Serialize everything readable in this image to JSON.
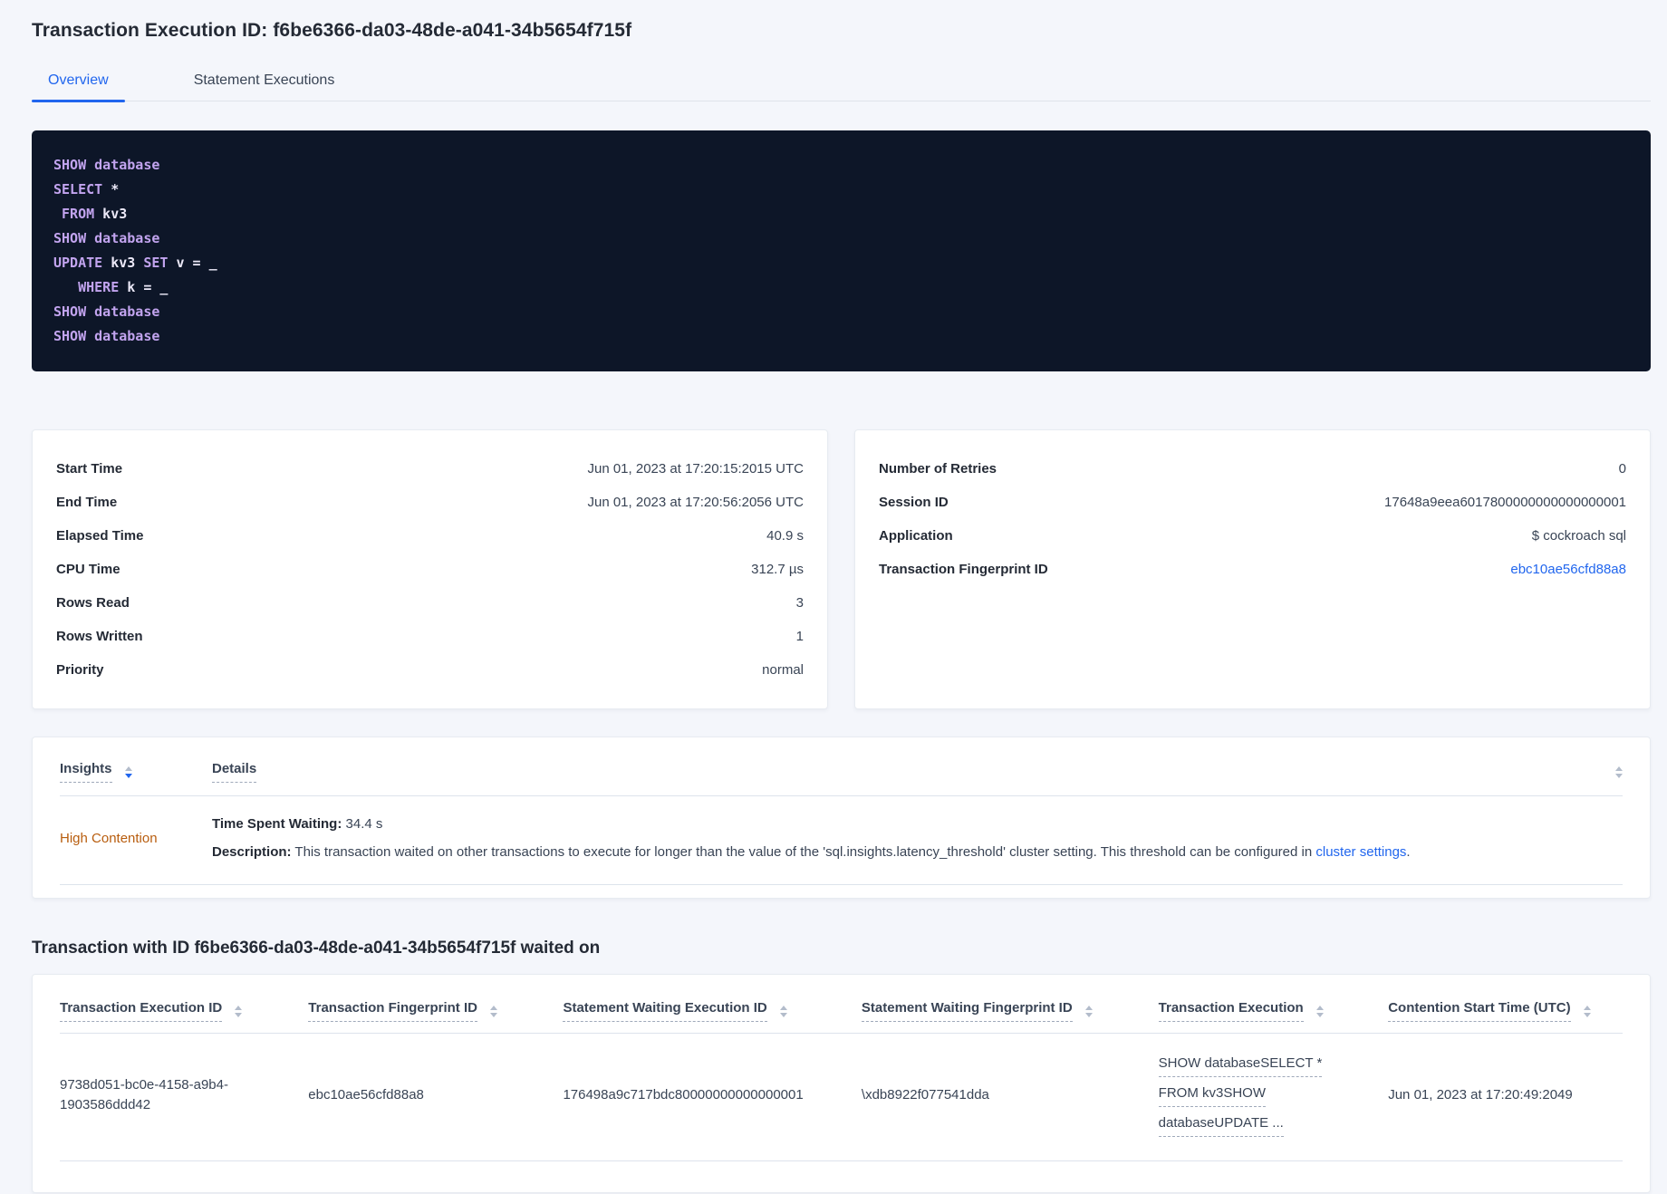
{
  "colors": {
    "accent_blue": "#2166ee",
    "insight_orange": "#b85d0e",
    "code_background": "#0d1628",
    "sql_keyword": "#c2a4ef",
    "sql_identifier": "#ece9f8",
    "page_background": "#f4f6fb"
  },
  "page": {
    "title": "Transaction Execution ID: f6be6366-da03-48de-a041-34b5654f715f"
  },
  "tabs": {
    "overview": "Overview",
    "statement_executions": "Statement Executions"
  },
  "sql": {
    "lines": [
      [
        {
          "t": "SHOW database",
          "c": "kw"
        }
      ],
      [
        {
          "t": "SELECT",
          "c": "kw"
        },
        {
          "t": " *",
          "c": "id"
        }
      ],
      [
        {
          "t": " FROM",
          "c": "kw"
        },
        {
          "t": " kv3",
          "c": "id"
        }
      ],
      [
        {
          "t": "SHOW database",
          "c": "kw"
        }
      ],
      [
        {
          "t": "UPDATE",
          "c": "kw"
        },
        {
          "t": " kv3 ",
          "c": "id"
        },
        {
          "t": "SET",
          "c": "kw"
        },
        {
          "t": " v = _",
          "c": "id"
        }
      ],
      [
        {
          "t": "   WHERE",
          "c": "kw"
        },
        {
          "t": " k = _",
          "c": "id"
        }
      ],
      [
        {
          "t": "SHOW database",
          "c": "kw"
        }
      ],
      [
        {
          "t": "SHOW database",
          "c": "kw"
        }
      ]
    ]
  },
  "summary_left": {
    "rows": [
      {
        "label": "Start Time",
        "value": "Jun 01, 2023 at 17:20:15:2015 UTC"
      },
      {
        "label": "End Time",
        "value": "Jun 01, 2023 at 17:20:56:2056 UTC"
      },
      {
        "label": "Elapsed Time",
        "value": "40.9 s"
      },
      {
        "label": "CPU Time",
        "value": "312.7 µs"
      },
      {
        "label": "Rows Read",
        "value": "3"
      },
      {
        "label": "Rows Written",
        "value": "1"
      },
      {
        "label": "Priority",
        "value": "normal"
      }
    ]
  },
  "summary_right": {
    "rows": [
      {
        "label": "Number of Retries",
        "value": "0"
      },
      {
        "label": "Session ID",
        "value": "17648a9eea6017800000000000000001"
      },
      {
        "label": "Application",
        "value": "$ cockroach sql"
      }
    ],
    "fingerprint_label": "Transaction Fingerprint ID",
    "fingerprint_value": "ebc10ae56cfd88a8"
  },
  "insights": {
    "col_insight": "Insights",
    "col_details": "Details",
    "row": {
      "insight": "High Contention",
      "waiting_label": "Time Spent Waiting:",
      "waiting_value": "34.4 s",
      "desc_label": "Description:",
      "desc_text": "This transaction waited on other transactions to execute for longer than the value of the 'sql.insights.latency_threshold' cluster setting. This threshold can be configured in",
      "desc_link": "cluster settings",
      "desc_period": "."
    }
  },
  "waited": {
    "heading": "Transaction with ID f6be6366-da03-48de-a041-34b5654f715f waited on",
    "columns": [
      "Transaction Execution ID",
      "Transaction Fingerprint ID",
      "Statement Waiting Execution ID",
      "Statement Waiting Fingerprint ID",
      "Transaction Execution",
      "Contention Start Time (UTC)"
    ],
    "row": {
      "txn_exec_id": "9738d051-bc0e-4158-a9b4-1903586ddd42",
      "txn_fingerprint_id": "ebc10ae56cfd88a8",
      "stmt_waiting_exec_id": "176498a9c717bdc80000000000000001",
      "stmt_waiting_fingerprint_id": "\\xdb8922f077541dda",
      "txn_exec_line1": "SHOW databaseSELECT *",
      "txn_exec_line2": "FROM kv3SHOW",
      "txn_exec_line3": "databaseUPDATE ...",
      "contention_start": "Jun 01, 2023 at 17:20:49:2049"
    }
  }
}
